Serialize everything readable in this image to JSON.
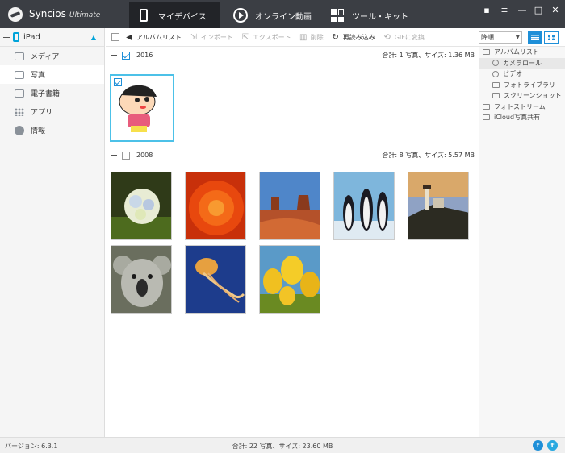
{
  "app": {
    "name": "Syncios",
    "edition": "Ultimate"
  },
  "main_tabs": [
    {
      "label": "マイデバイス",
      "icon": "phone-icon",
      "active": true
    },
    {
      "label": "オンライン動画",
      "icon": "play-icon",
      "active": false
    },
    {
      "label": "ツール・キット",
      "icon": "toolkit-icon",
      "active": false
    }
  ],
  "window_controls": {
    "chat": "▪",
    "menu": "≡",
    "minimize": "—",
    "maximize": "□",
    "close": "✕"
  },
  "device": {
    "name": "iPad"
  },
  "sidebar": {
    "items": [
      {
        "label": "メディア",
        "icon": "media-icon"
      },
      {
        "label": "写真",
        "icon": "photo-icon",
        "active": true
      },
      {
        "label": "電子書籍",
        "icon": "ebook-icon"
      },
      {
        "label": "アプリ",
        "icon": "apps-icon"
      },
      {
        "label": "情報",
        "icon": "info-icon"
      }
    ]
  },
  "toolbar": {
    "album_list": "アルバムリスト",
    "import": "インポート",
    "export": "エクスポート",
    "delete": "削除",
    "reload": "再読み込み",
    "gif": "GIFに変換"
  },
  "sort": {
    "selected": "降順"
  },
  "album_panel": {
    "items": [
      {
        "label": "アルバムリスト",
        "level": 0
      },
      {
        "label": "カメラロール",
        "level": 1,
        "selected": true
      },
      {
        "label": "ビデオ",
        "level": 1
      },
      {
        "label": "フォトライブラリ",
        "level": 1
      },
      {
        "label": "スクリーンショット",
        "level": 1
      },
      {
        "label": "フォトストリーム",
        "level": 0
      },
      {
        "label": "iCloud写真共有",
        "level": 0
      }
    ]
  },
  "groups": [
    {
      "year": "2016",
      "stats": "合計: 1 写真、サイズ: 1.36 MB",
      "checked": true
    },
    {
      "year": "2008",
      "stats": "合計: 8 写真、サイズ: 5.57 MB",
      "checked": false
    }
  ],
  "photos_2016": [
    {
      "name": "cartoon",
      "checked": true
    }
  ],
  "photos_2008": [
    {
      "name": "hydrangea"
    },
    {
      "name": "chrysanthemum"
    },
    {
      "name": "desert"
    },
    {
      "name": "penguins"
    },
    {
      "name": "lighthouse"
    },
    {
      "name": "koala"
    },
    {
      "name": "jellyfish"
    },
    {
      "name": "tulips"
    }
  ],
  "status": {
    "version": "バージョン: 6.3.1",
    "total": "合計: 22 写真、サイズ: 23.60 MB"
  },
  "social": {
    "facebook": "f",
    "twitter": "t"
  },
  "colors": {
    "accent": "#1e8fd8",
    "titlebar": "#3b3e44",
    "selection": "#4cc1e8"
  }
}
